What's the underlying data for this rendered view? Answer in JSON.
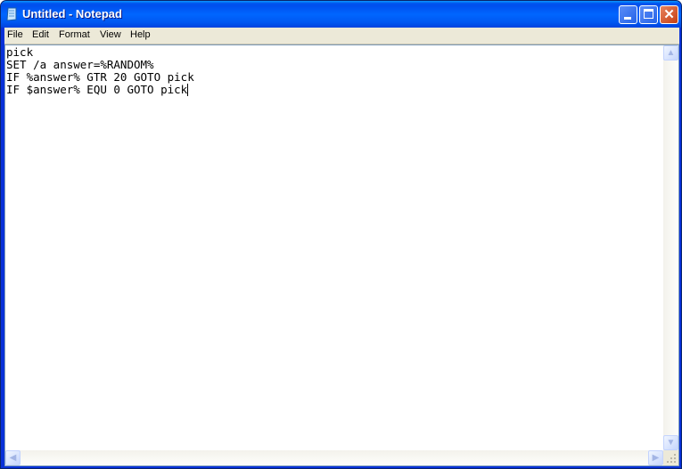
{
  "window": {
    "title": "Untitled - Notepad",
    "icon": "notepad-icon",
    "controls": {
      "minimize": "minimize-icon",
      "maximize": "maximize-icon",
      "close": "close-icon"
    }
  },
  "menu": {
    "items": [
      {
        "label": "File"
      },
      {
        "label": "Edit"
      },
      {
        "label": "Format"
      },
      {
        "label": "View"
      },
      {
        "label": "Help"
      }
    ]
  },
  "editor": {
    "lines": [
      "pick",
      "SET /a answer=%RANDOM%",
      "IF %answer% GTR 20 GOTO pick",
      "IF $answer% EQU 0 GOTO pick"
    ]
  },
  "scrollbars": {
    "up": "▲",
    "down": "▼",
    "left": "◀",
    "right": "▶"
  }
}
